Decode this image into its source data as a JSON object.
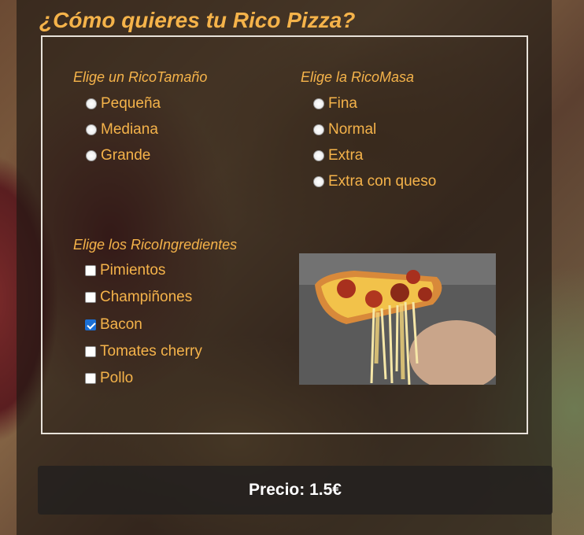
{
  "title": "¿Cómo quieres tu Rico Pizza?",
  "size": {
    "heading": "Elige un RicoTamaño",
    "options": [
      "Pequeña",
      "Mediana",
      "Grande"
    ]
  },
  "dough": {
    "heading": "Elige la RicoMasa",
    "options": [
      "Fina",
      "Normal",
      "Extra",
      "Extra con queso"
    ]
  },
  "ingredients": {
    "heading": "Elige los RicoIngredientes",
    "options": [
      {
        "label": "Pimientos",
        "checked": false
      },
      {
        "label": "Champiñones",
        "checked": false
      },
      {
        "label": "Bacon",
        "checked": true
      },
      {
        "label": "Tomates cherry",
        "checked": false
      },
      {
        "label": "Pollo",
        "checked": false
      }
    ]
  },
  "price": {
    "label": "Precio: 1.5€"
  },
  "colors": {
    "accent": "#f5b34a",
    "checkbox_checked": "#1a6fd6"
  }
}
